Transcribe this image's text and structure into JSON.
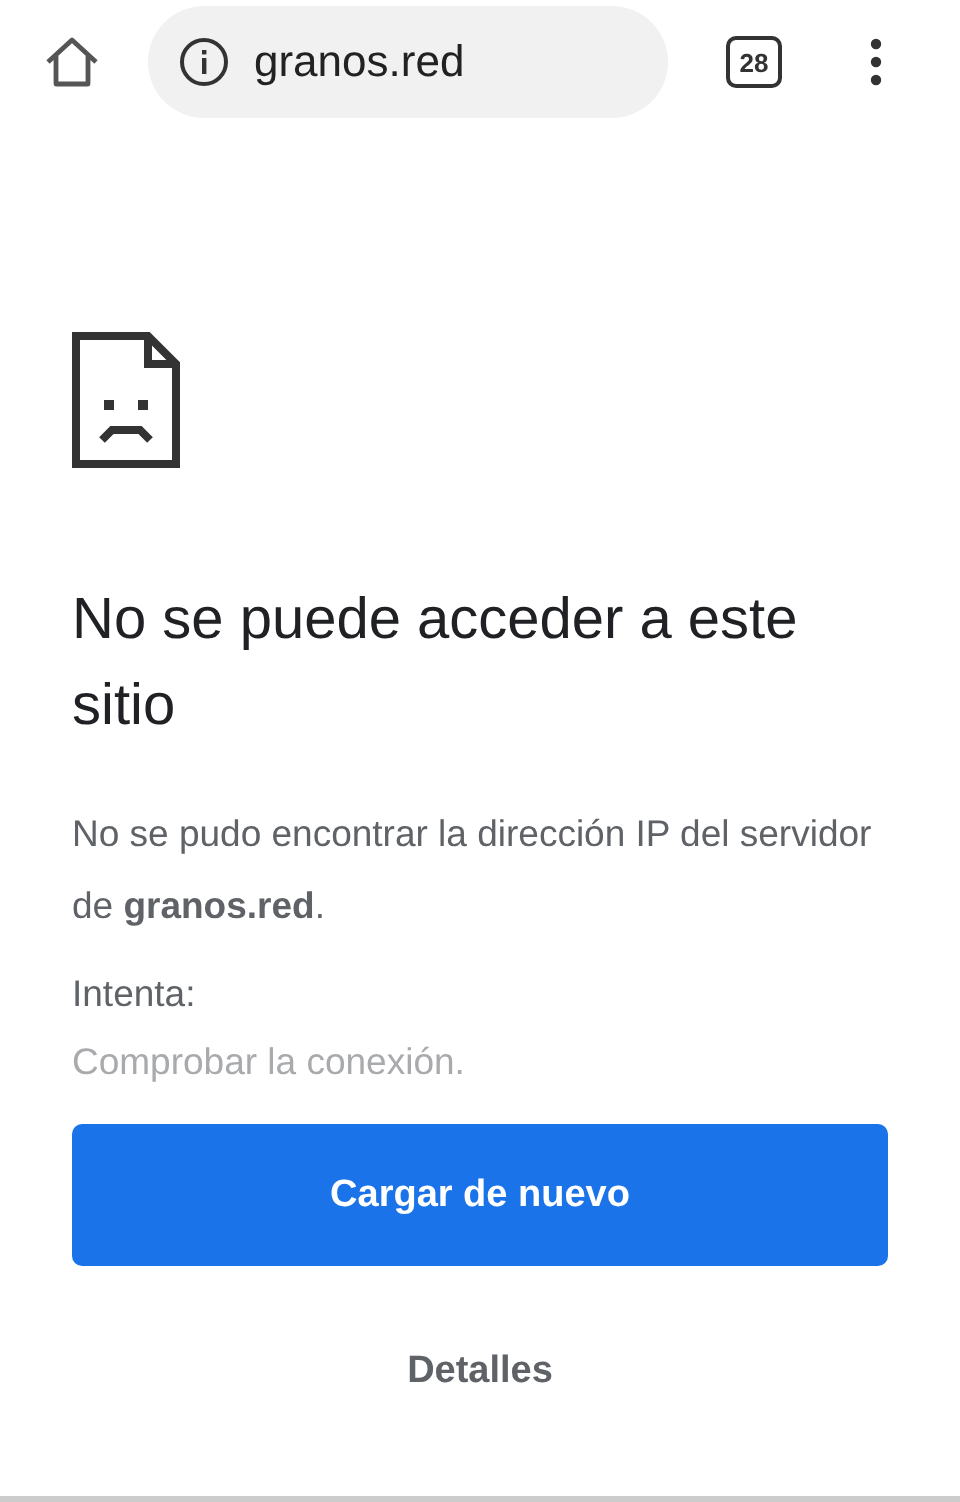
{
  "toolbar": {
    "url": "granos.red",
    "tab_count": "28"
  },
  "error": {
    "title": "No se puede acceder a este sitio",
    "message": "No se pudo encontrar la dirección IP del servidor de **granos.red**.",
    "suggestions_label": "Intenta:",
    "suggestions": [
      "Comprobar la conexión."
    ]
  },
  "buttons": {
    "reload": "Cargar de nuevo",
    "details": "Detalles"
  }
}
